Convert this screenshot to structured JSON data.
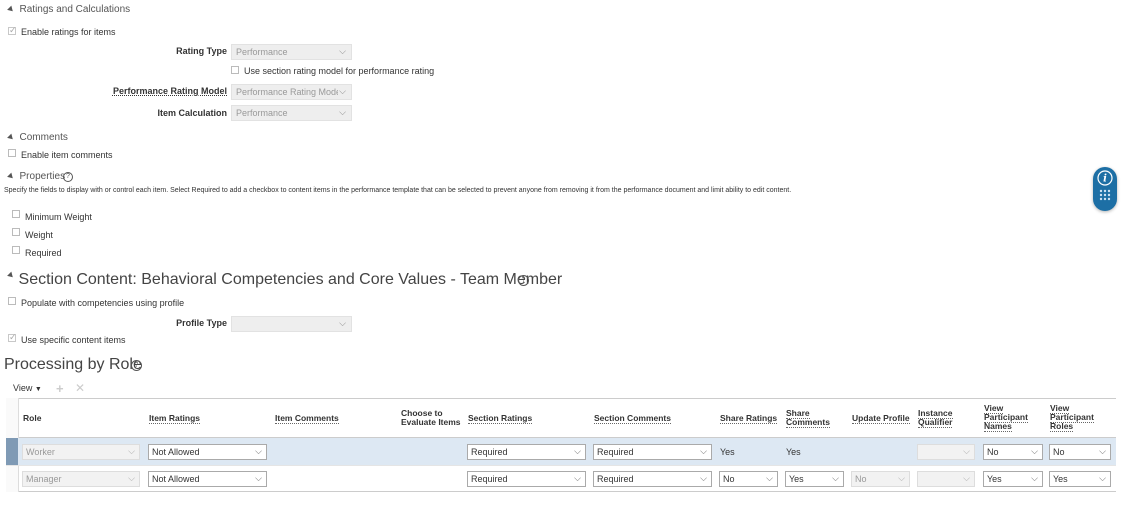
{
  "ratings": {
    "header": "Ratings and Calculations",
    "enable_ratings_label": "Enable ratings for items",
    "rating_type_label": "Rating Type",
    "rating_type_value": "Performance",
    "use_section_rating_label": "Use section rating model for performance rating",
    "perf_model_label": "Performance Rating Model",
    "perf_model_value": "Performance Rating Model",
    "item_calc_label": "Item Calculation",
    "item_calc_value": "Performance"
  },
  "comments": {
    "header": "Comments",
    "enable_comments_label": "Enable item comments"
  },
  "properties": {
    "header": "Properties",
    "help_text": "Specify the fields to display with or control each item. Select Required to add a checkbox to content items in the performance template that can be selected to prevent anyone from removing it from the performance document and limit ability to edit content.",
    "items": [
      "Minimum Weight",
      "Weight",
      "Required"
    ]
  },
  "section_content": {
    "header": "Section Content: Behavioral Competencies and Core Values - Team Member",
    "populate_label": "Populate with competencies using profile",
    "profile_type_label": "Profile Type",
    "profile_type_value": "",
    "use_specific_label": "Use specific content items"
  },
  "processing": {
    "header": "Processing by Role",
    "view_label": "View",
    "columns": {
      "role": "Role",
      "item_ratings": "Item Ratings",
      "item_comments": "Item Comments",
      "choose_evaluate_1": "Choose to",
      "choose_evaluate_2": "Evaluate Items",
      "section_ratings": "Section Ratings",
      "section_comments": "Section Comments",
      "share_ratings": "Share Ratings",
      "share_comments_1": "Share",
      "share_comments_2": "Comments",
      "update_profile": "Update Profile",
      "instance_qualifier_1": "Instance",
      "instance_qualifier_2": "Qualifier",
      "view_names_1": "View",
      "view_names_2": "Participant",
      "view_names_3": "Names",
      "view_roles_1": "View",
      "view_roles_2": "Participant",
      "view_roles_3": "Roles"
    },
    "rows": [
      {
        "role": "Worker",
        "item_ratings": "Not Allowed",
        "section_ratings": "Required",
        "section_comments": "Required",
        "share_ratings": "Yes",
        "share_comments": "Yes",
        "instance_qualifier": "",
        "view_names": "No",
        "view_roles": "No"
      },
      {
        "role": "Manager",
        "item_ratings": "Not Allowed",
        "section_ratings": "Required",
        "section_comments": "Required",
        "share_ratings": "No",
        "share_comments": "Yes",
        "update_profile": "No",
        "instance_qualifier": "",
        "view_names": "Yes",
        "view_roles": "Yes"
      }
    ]
  },
  "colors": {
    "accent": "#1d6fa5",
    "selected_row": "#dde8f3",
    "row_marker": "#7f9ab5"
  },
  "icons": {
    "info": "info-icon",
    "grid": "grid-icon"
  }
}
